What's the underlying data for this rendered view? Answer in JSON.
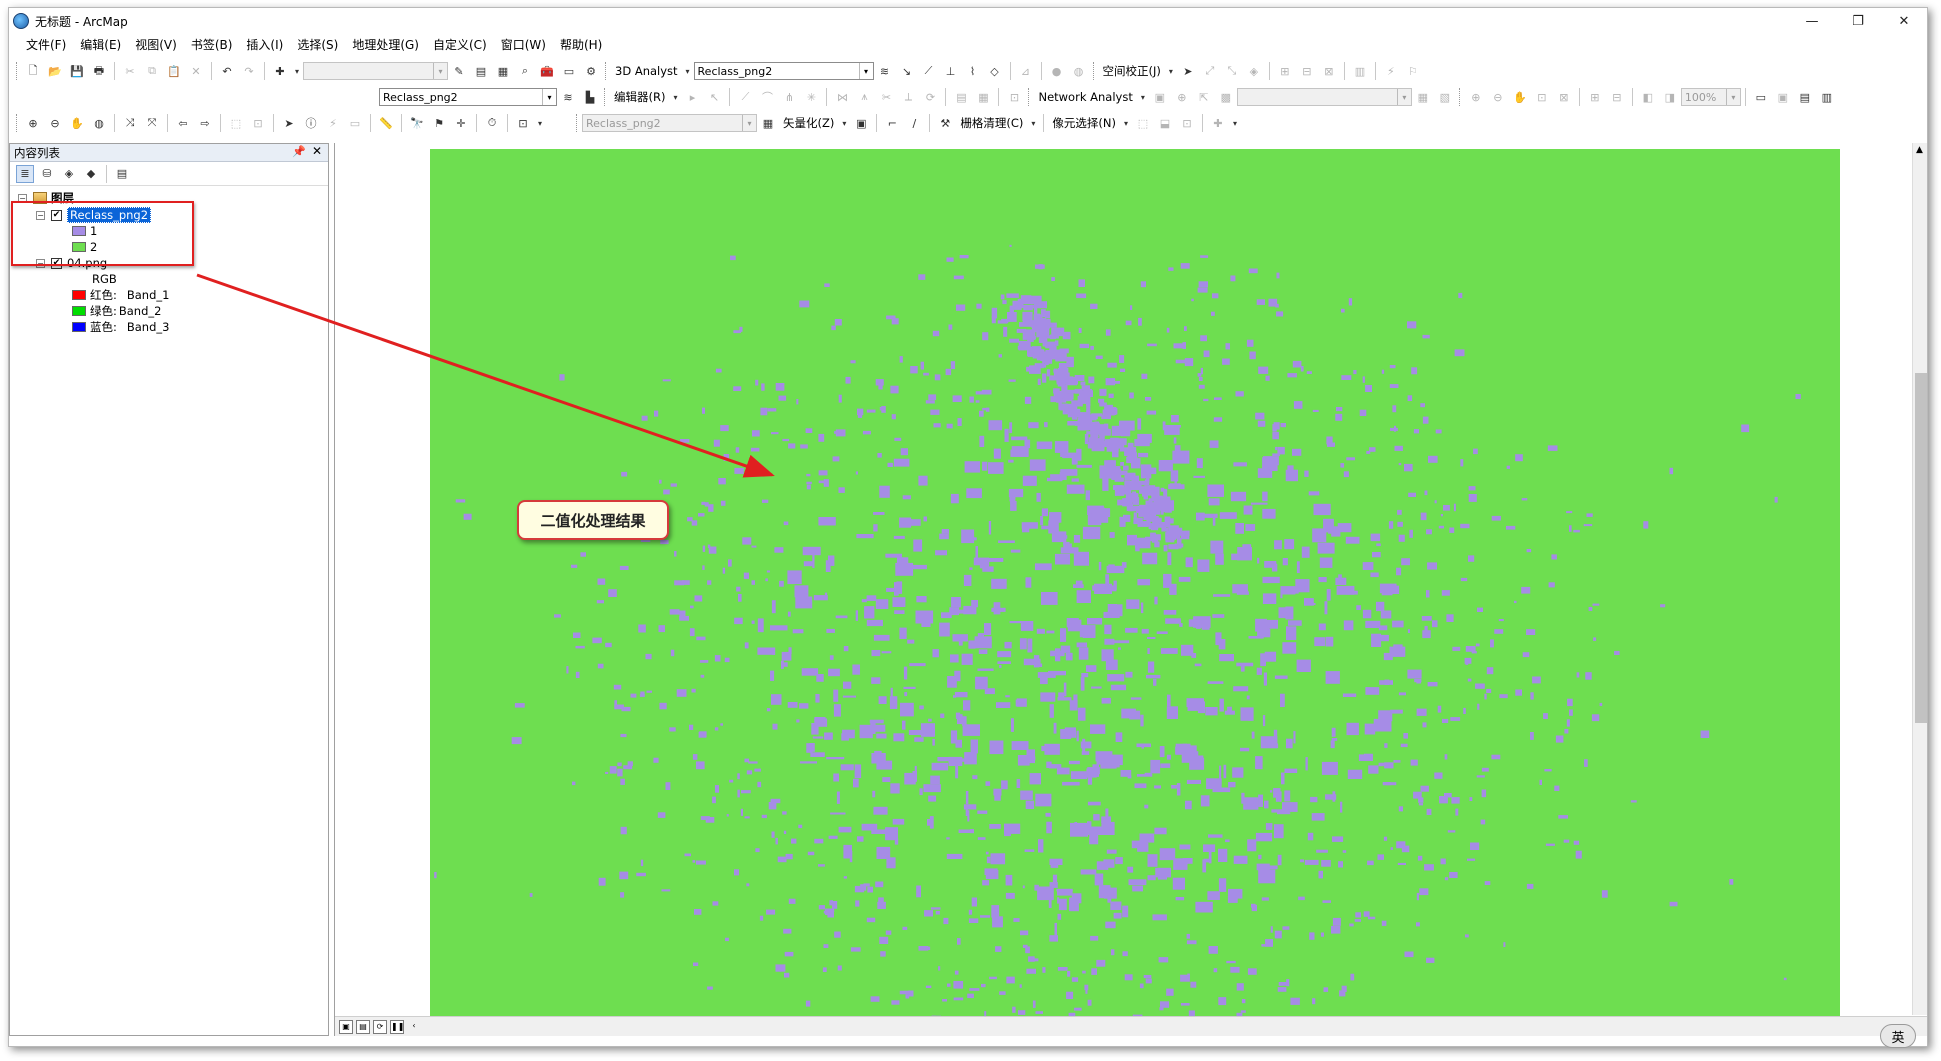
{
  "window": {
    "title": "无标题 - ArcMap",
    "controls": [
      "—",
      "❐",
      "✕"
    ]
  },
  "menu": [
    "文件(F)",
    "编辑(E)",
    "视图(V)",
    "书签(B)",
    "插入(I)",
    "选择(S)",
    "地理处理(G)",
    "自定义(C)",
    "窗口(W)",
    "帮助(H)"
  ],
  "toolbar1": {
    "analyst_label": "3D Analyst",
    "layer_combo": "Reclass_png2",
    "georef_label": "空间校正(J)"
  },
  "toolbar2": {
    "layer_combo": "Reclass_png2",
    "editor_label": "编辑器(R)",
    "network_label": "Network Analyst",
    "zoom_combo": "100%"
  },
  "toolbar3": {
    "layer_combo": "Reclass_png2",
    "vectorize_label": "矢量化(Z)",
    "raster_clean_label": "栅格清理(C)",
    "cell_select_label": "像元选择(N)"
  },
  "toc": {
    "title": "内容列表",
    "root_label": "图层",
    "layers": [
      {
        "name": "Reclass_png2",
        "classes": [
          {
            "label": "1",
            "color": "#a68ce6"
          },
          {
            "label": "2",
            "color": "#6ede50"
          }
        ]
      },
      {
        "name": "04.png",
        "type_label": "RGB",
        "bands": [
          {
            "channel": "红色:",
            "band": "Band_1",
            "color": "#ff0000"
          },
          {
            "channel": "绿色:",
            "band": "Band_2",
            "color": "#00dd00"
          },
          {
            "channel": "蓝色:",
            "band": "Band_3",
            "color": "#0000ff"
          }
        ]
      }
    ]
  },
  "map": {
    "background_color": "#6ede50",
    "urban_color": "#a68ce6"
  },
  "annotation": {
    "callout_text": "二值化处理结果",
    "arrow_color": "#e02020"
  },
  "ime": "英"
}
